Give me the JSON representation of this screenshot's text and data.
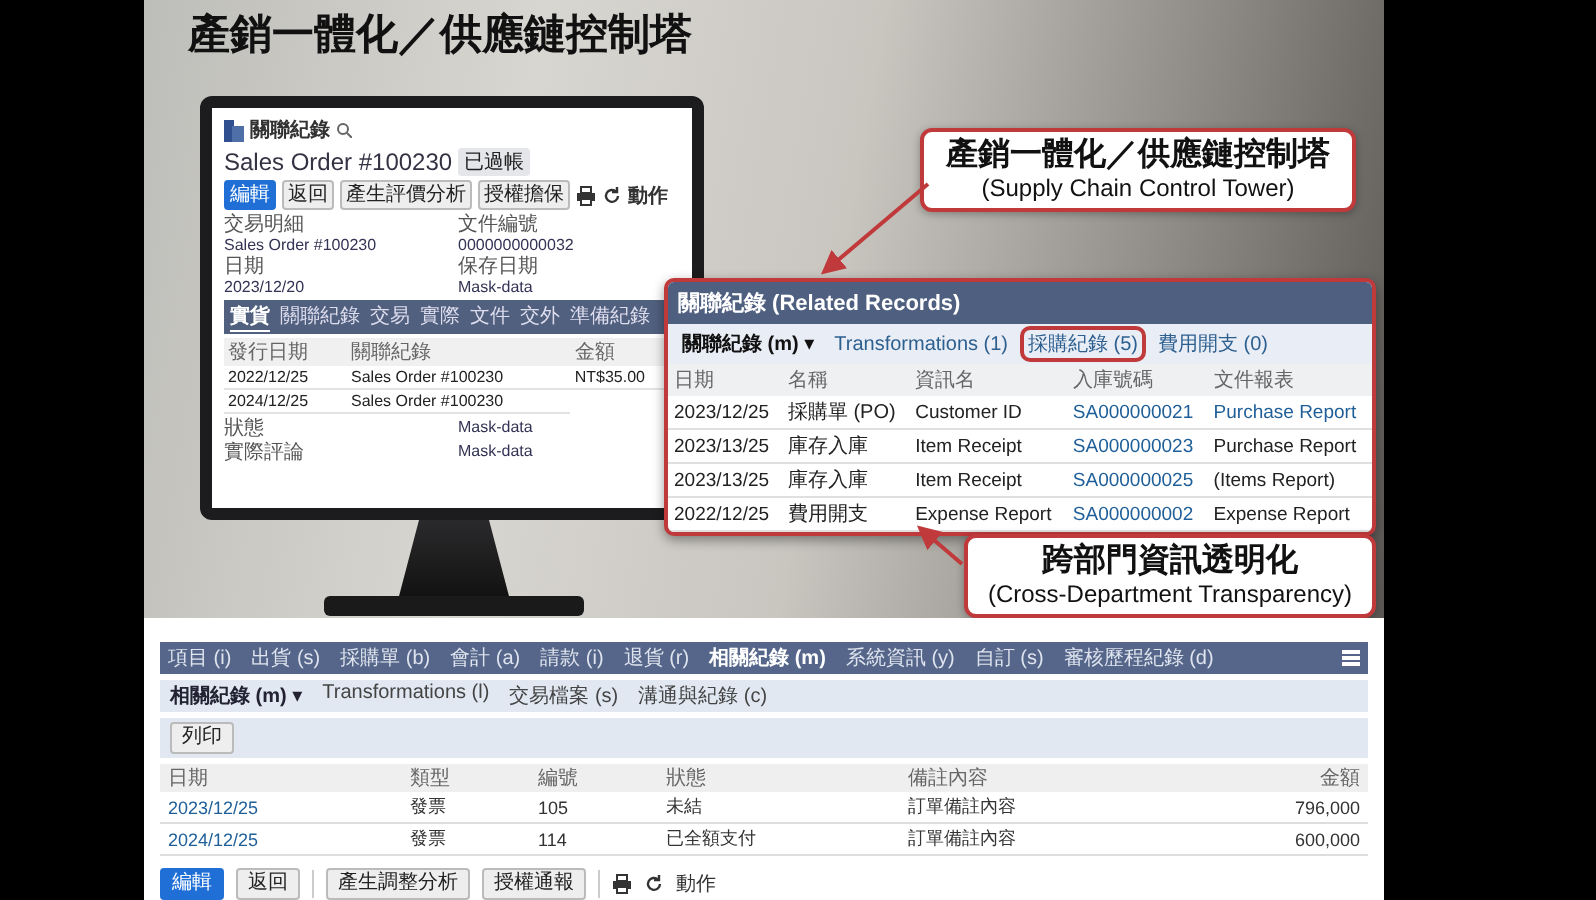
{
  "title": "產銷一體化／供應鏈控制塔",
  "monitor": {
    "app_title": "關聯紀錄",
    "sales_order": "Sales Order #100230",
    "status_badge": "已過帳",
    "buttons": [
      {
        "label": "編輯",
        "kind": "primary"
      },
      {
        "label": "返回",
        "kind": "default"
      },
      {
        "label": "產生評價分析",
        "kind": "default"
      },
      {
        "label": "授權擔保",
        "kind": "default"
      }
    ],
    "action_label": "動作",
    "fields": [
      {
        "label": "交易明細",
        "value": "Sales Order #100230"
      },
      {
        "label": "文件編號",
        "value": "0000000000032"
      },
      {
        "label": "日期",
        "value": "2023/12/20"
      },
      {
        "label": "保存日期",
        "value": "Mask-data"
      }
    ],
    "tabs": [
      {
        "label": "實貨",
        "selected": true
      },
      {
        "label": "關聯紀錄",
        "selected": false
      },
      {
        "label": "交易",
        "selected": false
      },
      {
        "label": "實際",
        "selected": false
      },
      {
        "label": "文件",
        "selected": false
      },
      {
        "label": "交外",
        "selected": false
      },
      {
        "label": "準備紀錄",
        "selected": false
      }
    ],
    "table": {
      "columns": [
        "發行日期",
        "關聯紀錄",
        "金額"
      ],
      "rows": [
        [
          "2022/12/25",
          "Sales Order #100230",
          "NT$35.00"
        ],
        [
          "2024/12/25",
          "Sales Order #100230"
        ]
      ]
    },
    "footer_fields": [
      {
        "label": "狀態",
        "value": "Mask-data"
      },
      {
        "label": "實際評論",
        "value": "Mask-data"
      }
    ]
  },
  "related_panel": {
    "title": "關聯紀錄 (Related Records)",
    "tabs": [
      {
        "label": "關聯紀錄 (m) ▾",
        "selected": true,
        "highlighted": false
      },
      {
        "label": "Transformations (1)",
        "selected": false,
        "highlighted": false
      },
      {
        "label": "採購紀錄 (5)",
        "selected": false,
        "highlighted": true
      },
      {
        "label": "費用開支 (0)",
        "selected": false,
        "highlighted": false
      }
    ],
    "columns": [
      "日期",
      "名稱",
      "資訊名",
      "入庫號碼",
      "文件報表"
    ],
    "rows": [
      [
        {
          "text": "2023/12/25",
          "link": false
        },
        {
          "text": "採購單 (PO)",
          "link": false
        },
        {
          "text": "Customer ID",
          "link": false
        },
        {
          "text": "SA000000021",
          "link": true
        },
        {
          "text": "Purchase Report",
          "link": true
        }
      ],
      [
        {
          "text": "2023/13/25",
          "link": false
        },
        {
          "text": "庫存入庫",
          "link": false
        },
        {
          "text": "Item Receipt",
          "link": false
        },
        {
          "text": "SA000000023",
          "link": true
        },
        {
          "text": "Purchase Report",
          "link": false
        }
      ],
      [
        {
          "text": "2023/13/25",
          "link": false
        },
        {
          "text": "庫存入庫",
          "link": false
        },
        {
          "text": "Item Receipt",
          "link": false
        },
        {
          "text": "SA000000025",
          "link": true
        },
        {
          "text": "(Items Report)",
          "link": false
        }
      ],
      [
        {
          "text": "2022/12/25",
          "link": false
        },
        {
          "text": "費用開支",
          "link": false
        },
        {
          "text": "Expense Report",
          "link": false
        },
        {
          "text": "SA000000002",
          "link": true
        },
        {
          "text": "Expense Report",
          "link": false
        }
      ]
    ]
  },
  "callouts": [
    {
      "title": "產銷一體化／供應鏈控制塔",
      "subtitle": "(Supply Chain Control Tower)"
    },
    {
      "title": "跨部門資訊透明化",
      "subtitle": "(Cross-Department Transparency)"
    }
  ],
  "erp": {
    "tabs": [
      {
        "label": "項目 (i)",
        "selected": false
      },
      {
        "label": "出貨 (s)",
        "selected": false
      },
      {
        "label": "採購單 (b)",
        "selected": false
      },
      {
        "label": "會計 (a)",
        "selected": false
      },
      {
        "label": "請款 (i)",
        "selected": false
      },
      {
        "label": "退貨 (r)",
        "selected": false
      },
      {
        "label": "相關紀錄 (m)",
        "selected": true
      },
      {
        "label": "系統資訊 (y)",
        "selected": false
      },
      {
        "label": "自訂 (s)",
        "selected": false
      },
      {
        "label": "審核歷程紀錄 (d)",
        "selected": false
      }
    ],
    "subtabs": [
      {
        "label": "相關紀錄 (m) ▾",
        "selected": true
      },
      {
        "label": "Transformations (l)",
        "selected": false
      },
      {
        "label": "交易檔案 (s)",
        "selected": false
      },
      {
        "label": "溝通與紀錄 (c)",
        "selected": false
      }
    ],
    "print_button": "列印",
    "columns": [
      "日期",
      "類型",
      "編號",
      "狀態",
      "備註內容",
      "金額"
    ],
    "rows": [
      [
        {
          "text": "2023/12/25",
          "link": true
        },
        {
          "text": "發票",
          "link": false
        },
        {
          "text": "105",
          "link": false
        },
        {
          "text": "未結",
          "link": false
        },
        {
          "text": "訂單備註內容",
          "link": false
        },
        {
          "text": "796,000",
          "link": false
        }
      ],
      [
        {
          "text": "2024/12/25",
          "link": true
        },
        {
          "text": "發票",
          "link": false
        },
        {
          "text": "114",
          "link": false
        },
        {
          "text": "已全額支付",
          "link": false
        },
        {
          "text": "訂單備註內容",
          "link": false
        },
        {
          "text": "600,000",
          "link": false
        }
      ]
    ],
    "buttons": [
      {
        "label": "編輯",
        "kind": "primary"
      },
      {
        "label": "返回",
        "kind": "default"
      },
      {
        "label": "產生調整分析",
        "kind": "default"
      },
      {
        "label": "授權通報",
        "kind": "default"
      }
    ],
    "action_label": "動作"
  }
}
